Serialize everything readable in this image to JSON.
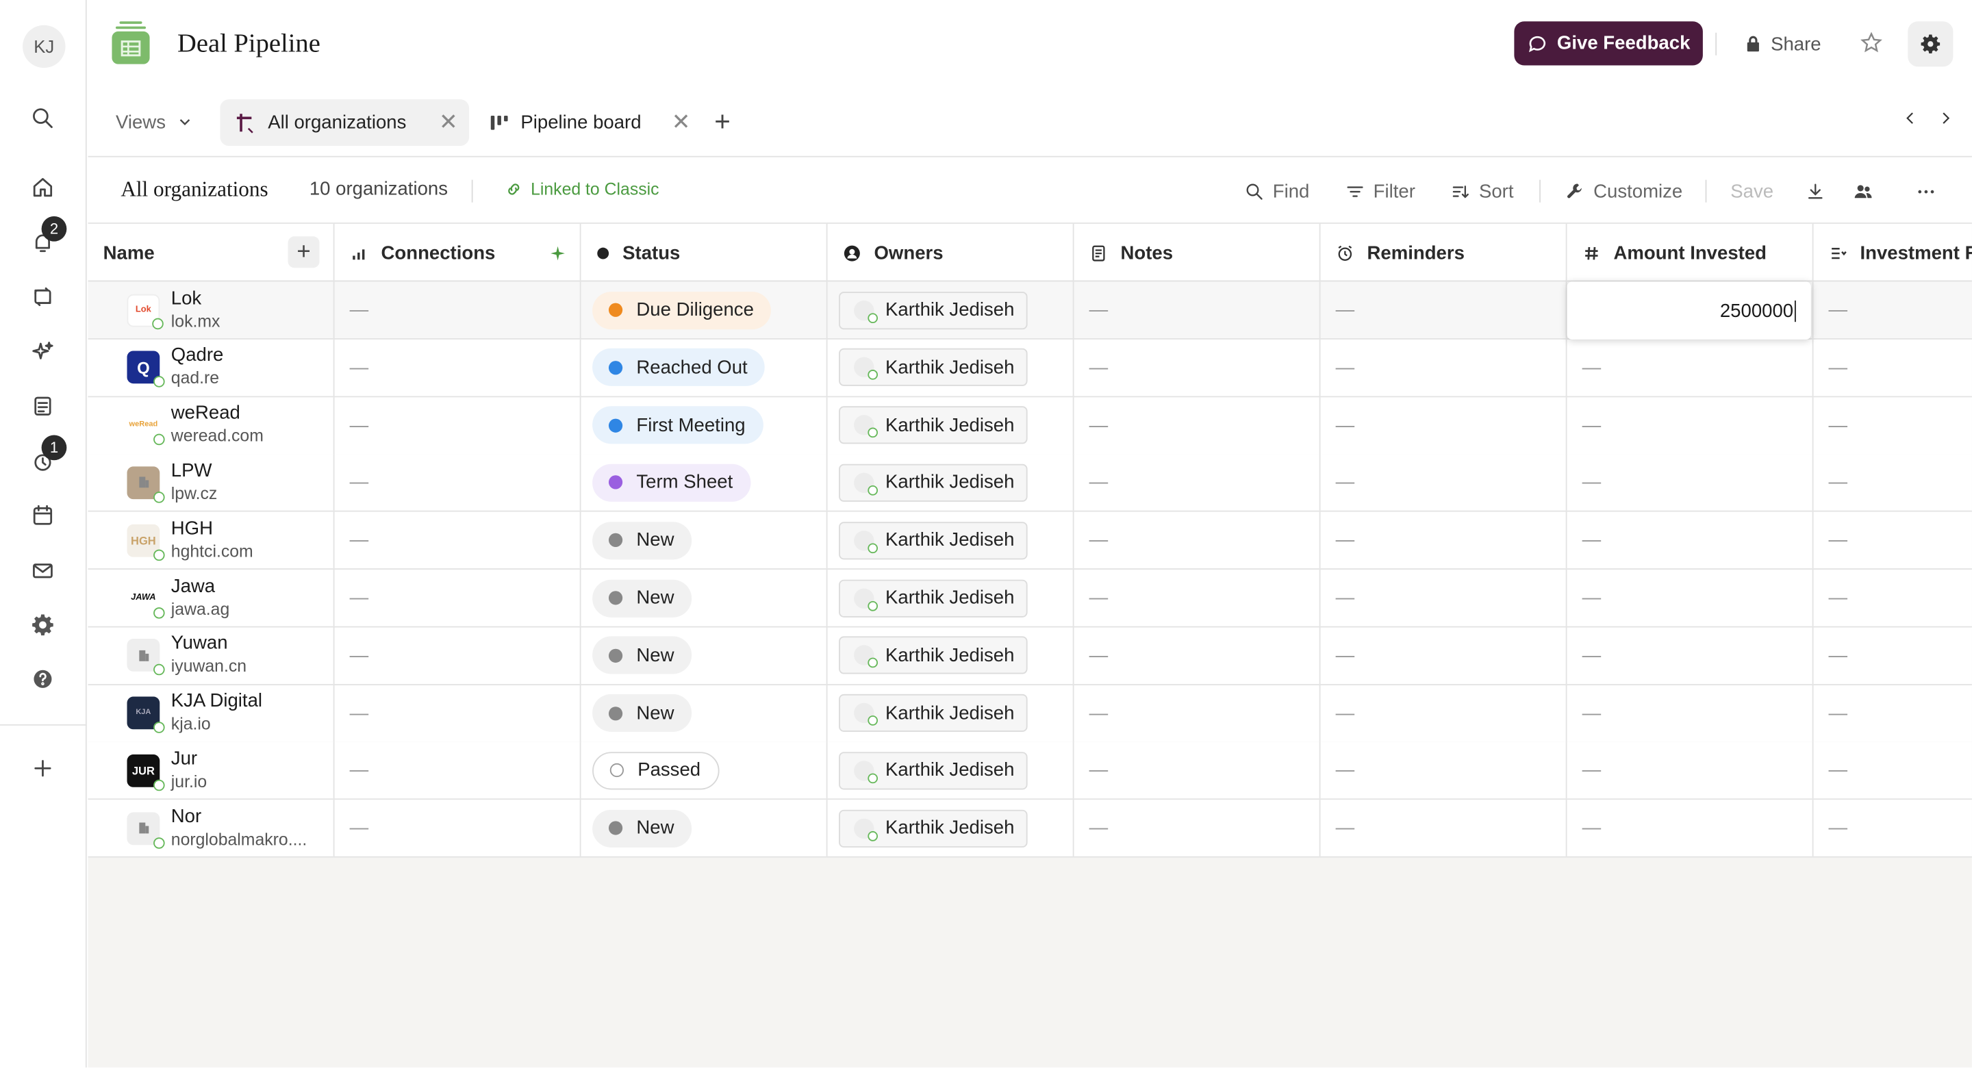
{
  "user": {
    "initials": "KJ"
  },
  "rail": {
    "notifications_badge": "2",
    "reminders_badge": "1"
  },
  "header": {
    "title": "Deal Pipeline",
    "feedback_label": "Give Feedback",
    "share_label": "Share"
  },
  "tabs": {
    "views_label": "Views",
    "items": [
      {
        "label": "All organizations",
        "active": true
      },
      {
        "label": "Pipeline board",
        "active": false
      }
    ]
  },
  "viewbar": {
    "title": "All organizations",
    "count": "10 organizations",
    "linked_label": "Linked to Classic",
    "find": "Find",
    "filter": "Filter",
    "sort": "Sort",
    "customize": "Customize",
    "save": "Save"
  },
  "columns": [
    "Name",
    "Connections",
    "Status",
    "Owners",
    "Notes",
    "Reminders",
    "Amount Invested",
    "Investment Re"
  ],
  "empty_value": "—",
  "editing_value": "2500000",
  "rows": [
    {
      "name": "Lok",
      "domain": "lok.mx",
      "status": "Due Diligence",
      "owner": "Karthik Jediseh",
      "logo_text": "Lok"
    },
    {
      "name": "Qadre",
      "domain": "qad.re",
      "status": "Reached Out",
      "owner": "Karthik Jediseh",
      "logo_text": "Q"
    },
    {
      "name": "weRead",
      "domain": "weread.com",
      "status": "First Meeting",
      "owner": "Karthik Jediseh",
      "logo_text": "weRead"
    },
    {
      "name": "LPW",
      "domain": "lpw.cz",
      "status": "Term Sheet",
      "owner": "Karthik Jediseh",
      "logo_text": ""
    },
    {
      "name": "HGH",
      "domain": "hghtci.com",
      "status": "New",
      "owner": "Karthik Jediseh",
      "logo_text": "HGH"
    },
    {
      "name": "Jawa",
      "domain": "jawa.ag",
      "status": "New",
      "owner": "Karthik Jediseh",
      "logo_text": "JAWA"
    },
    {
      "name": "Yuwan",
      "domain": "iyuwan.cn",
      "status": "New",
      "owner": "Karthik Jediseh",
      "logo_text": ""
    },
    {
      "name": "KJA Digital",
      "domain": "kja.io",
      "status": "New",
      "owner": "Karthik Jediseh",
      "logo_text": "KJA"
    },
    {
      "name": "Jur",
      "domain": "jur.io",
      "status": "Passed",
      "owner": "Karthik Jediseh",
      "logo_text": "JUR"
    },
    {
      "name": "Nor",
      "domain": "norglobalmakro....",
      "status": "New",
      "owner": "Karthik Jediseh",
      "logo_text": ""
    }
  ],
  "status_colors": {
    "Due Diligence": {
      "dot": "#ef8a1e",
      "bg": "#fdf0e3"
    },
    "Reached Out": {
      "dot": "#2f86e4",
      "bg": "#e8f2fc"
    },
    "First Meeting": {
      "dot": "#2f86e4",
      "bg": "#e8f2fc"
    },
    "Term Sheet": {
      "dot": "#9a5fe0",
      "bg": "#f2ecfb"
    },
    "New": {
      "dot": "#888888",
      "bg": "#f1f1f1"
    },
    "Passed": {
      "dot": "#ffffff",
      "bg": "#ffffff"
    }
  },
  "colors": {
    "feedback_bg": "#4a1b3d",
    "linked": "#4a9a3f",
    "app_icon": "#7dbb6b"
  }
}
